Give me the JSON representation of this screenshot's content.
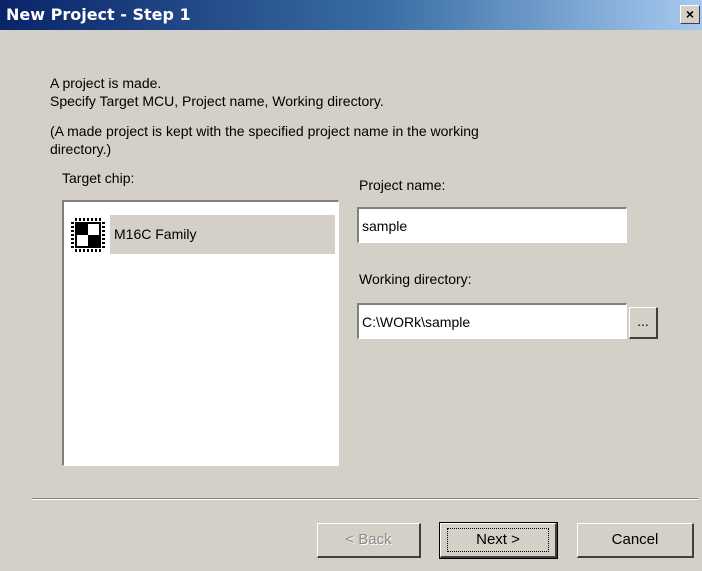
{
  "window": {
    "title": "New Project - Step 1",
    "close_label": "×"
  },
  "intro": {
    "line1": "A project is made.",
    "line2": "Specify Target MCU, Project name, Working directory.",
    "note_line1": "(A made project is kept with the specified project name in the working",
    "note_line2": "directory.)"
  },
  "target_chip": {
    "label": "Target chip:",
    "items": [
      {
        "label": "M16C Family",
        "icon": "chip-icon"
      }
    ]
  },
  "project_name": {
    "label": "Project name:",
    "value": "sample"
  },
  "working_directory": {
    "label": "Working directory:",
    "value": "C:\\WORk\\sample",
    "browse_label": "..."
  },
  "buttons": {
    "back_label": "< Back",
    "next_label": "Next >",
    "cancel_label": "Cancel"
  }
}
